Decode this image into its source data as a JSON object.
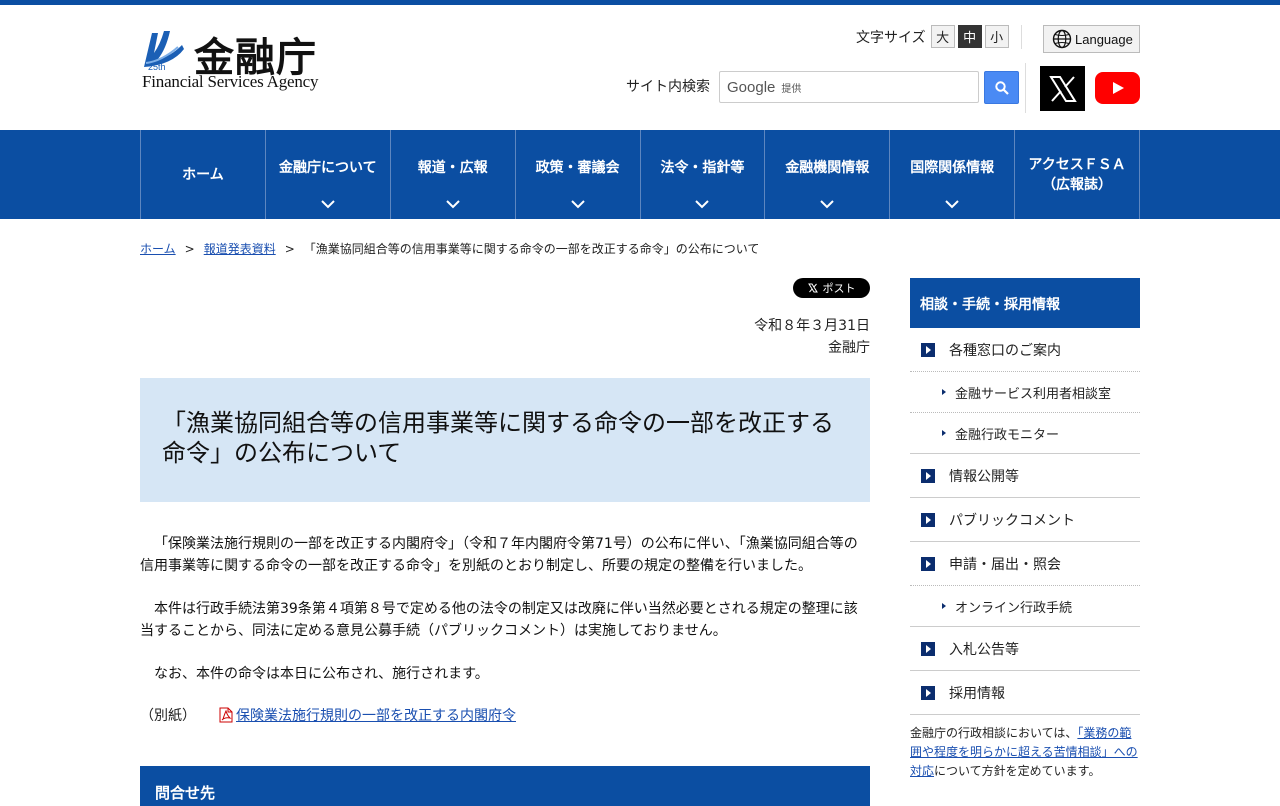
{
  "header": {
    "logo_kanji": "金融庁",
    "logo_en": "Financial Services Agency",
    "fontsize_label": "文字サイズ",
    "fontsize_options": [
      "大",
      "中",
      "小"
    ],
    "fontsize_selected": "中",
    "language_label": "Language",
    "search_label": "サイト内検索",
    "search_brand": "Google",
    "search_brand_suffix": "提供"
  },
  "nav": {
    "items": [
      {
        "label": "ホーム"
      },
      {
        "label": "金融庁について"
      },
      {
        "label": "報道・広報"
      },
      {
        "label": "政策・審議会"
      },
      {
        "label": "法令・指針等"
      },
      {
        "label": "金融機関情報"
      },
      {
        "label": "国際関係情報"
      },
      {
        "label": "アクセスＦＳＡ",
        "label2": "（広報誌）"
      }
    ]
  },
  "breadcrumb": {
    "home": "ホーム",
    "press": "報道発表資料",
    "current": "「漁業協同組合等の信用事業等に関する命令の一部を改正する命令」の公布について"
  },
  "main": {
    "post_label": "ポスト",
    "date": "令和８年３月31日",
    "issuer": "金融庁",
    "title": "「漁業協同組合等の信用事業等に関する命令の一部を改正する命令」の公布について",
    "paragraphs": [
      "「保険業法施行規則の一部を改正する内閣府令」（令和７年内閣府令第71号）の公布に伴い、「漁業協同組合等の信用事業等に関する命令の一部を改正する命令」を別紙のとおり制定し、所要の規定の整備を行いました。",
      "本件は行政手続法第39条第４項第８号で定める他の法令の制定又は改廃に伴い当然必要とされる規定の整理に該当することから、同法に定める意見公募手続（パブリックコメント）は実施しておりません。",
      "なお、本件の命令は本日に公布され、施行されます。"
    ],
    "attachment_label": "（別紙）",
    "attachment_link": "保険業法施行規則の一部を改正する内閣府令",
    "contact_heading": "問合せ先"
  },
  "sidebar": {
    "heading": "相談・手続・採用情報",
    "item_madoguchi": "各種窓口のご案内",
    "sub_riyousha": "金融サービス利用者相談室",
    "sub_monitor": "金融行政モニター",
    "item_joho": "情報公開等",
    "item_pubcom": "パブリックコメント",
    "item_shinsei": "申請・届出・照会",
    "sub_online": "オンライン行政手続",
    "item_nyusatsu": "入札公告等",
    "item_saiyo": "採用情報",
    "note_pre": "金融庁の行政相談においては、",
    "note_link": "「業務の範囲や程度を明らかに超える苦情相談」への対応",
    "note_post": "について方針を定めています。"
  },
  "colors": {
    "brand_blue": "#0b4ea2",
    "title_bg": "#d6e6f5",
    "link": "#1a4fb0"
  }
}
